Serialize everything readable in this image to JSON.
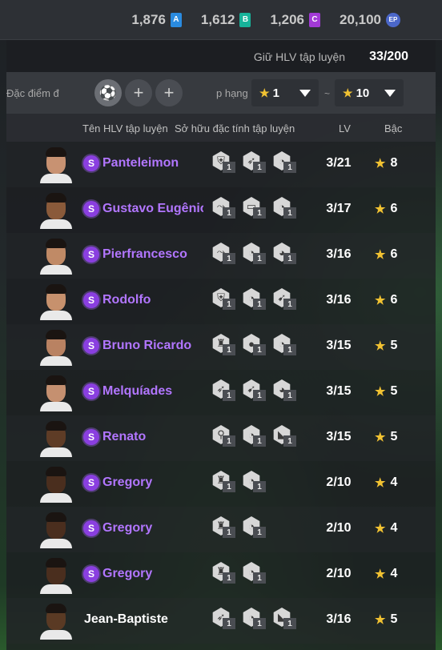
{
  "currency": [
    {
      "amount": "1,876",
      "badge": "A",
      "color": "#2a8be0"
    },
    {
      "amount": "1,612",
      "badge": "B",
      "color": "#17b39a"
    },
    {
      "amount": "1,206",
      "badge": "C",
      "color": "#a23ad6"
    },
    {
      "amount": "20,100",
      "badge": "EP",
      "color": "#4b67c9"
    }
  ],
  "hold": {
    "label": "Giữ HLV tập luyện",
    "count": "33/200"
  },
  "filters": {
    "trait_label": "Đặc điểm đ",
    "rank_label": "p hạng",
    "rank_min": "1",
    "rank_max": "10",
    "tilde": "~",
    "plus": "+"
  },
  "columns": {
    "name": "Tên HLV tập luyện",
    "traits": "Sở hữu đặc tính tập luyện",
    "lv": "LV",
    "rank": "Bậc"
  },
  "rows": [
    {
      "name": "Panteleimon",
      "special": true,
      "lv": "3/21",
      "rank": "8",
      "skin": "#c89272",
      "trait_icons": [
        "shield-icon",
        "kick-icon",
        "dribble-icon"
      ],
      "trait_levels": [
        "1",
        "1",
        "1"
      ]
    },
    {
      "name": "Gustavo Eugênio",
      "special": true,
      "lv": "3/17",
      "rank": "6",
      "skin": "#8a5a3a",
      "trait_icons": [
        "tackle-icon",
        "goal-icon",
        "dribble-icon"
      ],
      "trait_levels": [
        "1",
        "1",
        "1"
      ]
    },
    {
      "name": "Pierfrancesco",
      "special": true,
      "lv": "3/16",
      "rank": "6",
      "skin": "#c08a66",
      "trait_icons": [
        "tackle-icon",
        "dribble-icon",
        "header-icon"
      ],
      "trait_levels": [
        "1",
        "1",
        "1"
      ]
    },
    {
      "name": "Rodolfo",
      "special": true,
      "lv": "3/16",
      "rank": "6",
      "skin": "#c7916d",
      "trait_icons": [
        "shield-icon",
        "dribble-icon",
        "shot-icon"
      ],
      "trait_levels": [
        "1",
        "1",
        "1"
      ]
    },
    {
      "name": "Bruno Ricardo",
      "special": true,
      "lv": "3/15",
      "rank": "5",
      "skin": "#b98262",
      "trait_icons": [
        "trophy-icon",
        "ball-icon",
        "dribble-icon"
      ],
      "trait_levels": [
        "1",
        "1",
        "1"
      ]
    },
    {
      "name": "Melquíades",
      "special": true,
      "lv": "3/15",
      "rank": "5",
      "skin": "#c59070",
      "trait_icons": [
        "kick-icon",
        "shot-icon",
        "header-icon"
      ],
      "trait_levels": [
        "1",
        "1",
        "1"
      ]
    },
    {
      "name": "Renato",
      "special": true,
      "lv": "3/15",
      "rank": "5",
      "skin": "#5e3c26",
      "trait_icons": [
        "runner-icon",
        "dribble-icon",
        "boot-icon"
      ],
      "trait_levels": [
        "1",
        "1",
        "1"
      ]
    },
    {
      "name": "Gregory",
      "special": true,
      "lv": "2/10",
      "rank": "4",
      "skin": "#4a2e1e",
      "trait_icons": [
        "trophy-icon",
        "dribble-icon"
      ],
      "trait_levels": [
        "1",
        "1"
      ]
    },
    {
      "name": "Gregory",
      "special": true,
      "lv": "2/10",
      "rank": "4",
      "skin": "#4a2e1e",
      "trait_icons": [
        "trophy-icon",
        "dribble-icon"
      ],
      "trait_levels": [
        "1",
        "1"
      ]
    },
    {
      "name": "Gregory",
      "special": true,
      "lv": "2/10",
      "rank": "4",
      "skin": "#4a2e1e",
      "trait_icons": [
        "trophy-icon",
        "dribble-icon"
      ],
      "trait_levels": [
        "1",
        "1"
      ]
    },
    {
      "name": "Jean-Baptiste",
      "special": false,
      "lv": "3/16",
      "rank": "5",
      "skin": "#5a3a24",
      "trait_icons": [
        "kick-icon",
        "dribble-icon",
        "boot-icon"
      ],
      "trait_levels": [
        "1",
        "1",
        "1"
      ]
    }
  ]
}
